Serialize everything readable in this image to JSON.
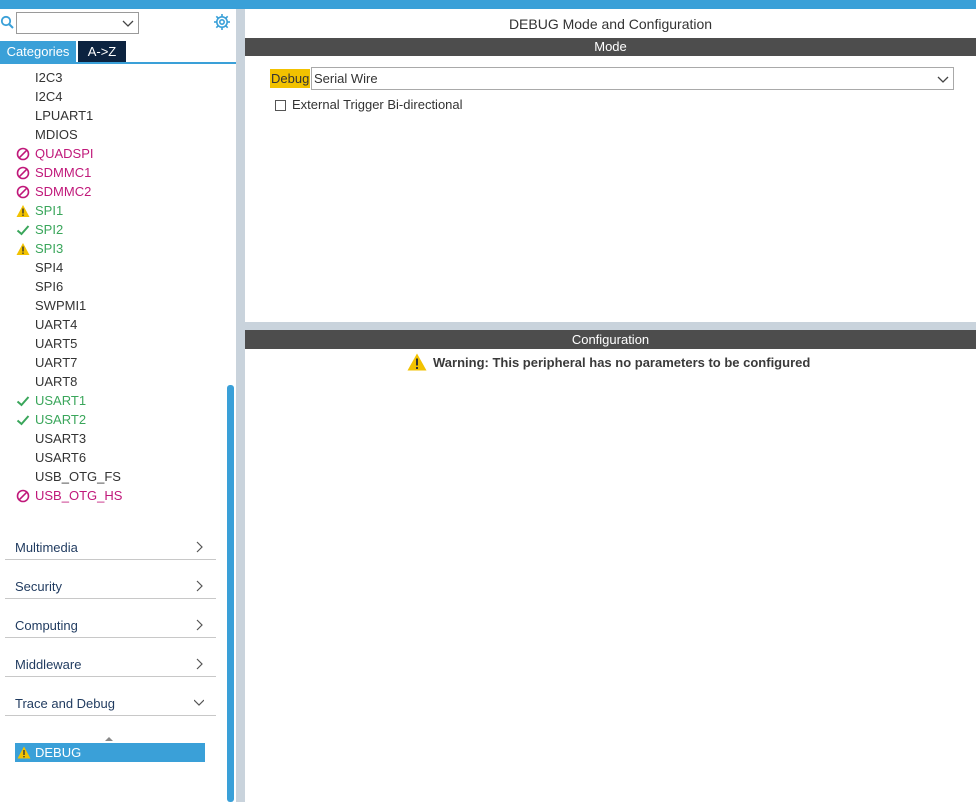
{
  "colors": {
    "accent": "#3aa0d8",
    "dark_tab": "#0c2340",
    "bar": "#4d4d4d",
    "disabled": "#c0187a",
    "ok": "#3aa65b",
    "warning": "#f2c200",
    "category_text": "#1f3a5f"
  },
  "sidebar": {
    "tabs": [
      "Categories",
      "A->Z"
    ],
    "peripherals": [
      {
        "label": "I2C3",
        "status": "normal"
      },
      {
        "label": "I2C4",
        "status": "normal"
      },
      {
        "label": "LPUART1",
        "status": "normal"
      },
      {
        "label": "MDIOS",
        "status": "normal"
      },
      {
        "label": "QUADSPI",
        "status": "disabled"
      },
      {
        "label": "SDMMC1",
        "status": "disabled"
      },
      {
        "label": "SDMMC2",
        "status": "disabled"
      },
      {
        "label": "SPI1",
        "status": "warn"
      },
      {
        "label": "SPI2",
        "status": "ok"
      },
      {
        "label": "SPI3",
        "status": "warn"
      },
      {
        "label": "SPI4",
        "status": "normal"
      },
      {
        "label": "SPI6",
        "status": "normal"
      },
      {
        "label": "SWPMI1",
        "status": "normal"
      },
      {
        "label": "UART4",
        "status": "normal"
      },
      {
        "label": "UART5",
        "status": "normal"
      },
      {
        "label": "UART7",
        "status": "normal"
      },
      {
        "label": "UART8",
        "status": "normal"
      },
      {
        "label": "USART1",
        "status": "ok"
      },
      {
        "label": "USART2",
        "status": "ok"
      },
      {
        "label": "USART3",
        "status": "normal"
      },
      {
        "label": "USART6",
        "status": "normal"
      },
      {
        "label": "USB_OTG_FS",
        "status": "normal"
      },
      {
        "label": "USB_OTG_HS",
        "status": "disabled"
      }
    ],
    "categories": [
      {
        "label": "Multimedia",
        "expanded": false
      },
      {
        "label": "Security",
        "expanded": false
      },
      {
        "label": "Computing",
        "expanded": false
      },
      {
        "label": "Middleware",
        "expanded": false
      },
      {
        "label": "Trace and Debug",
        "expanded": true
      }
    ],
    "selected_item": {
      "label": "DEBUG",
      "status": "warn"
    }
  },
  "main": {
    "title": "DEBUG Mode and Configuration",
    "mode_header": "Mode",
    "debug_label": "Debug",
    "debug_value": "Serial Wire",
    "external_trigger_label": "External Trigger Bi-directional",
    "external_trigger_checked": false,
    "config_header": "Configuration",
    "warning_text": "Warning: This peripheral has no parameters to be configured"
  }
}
